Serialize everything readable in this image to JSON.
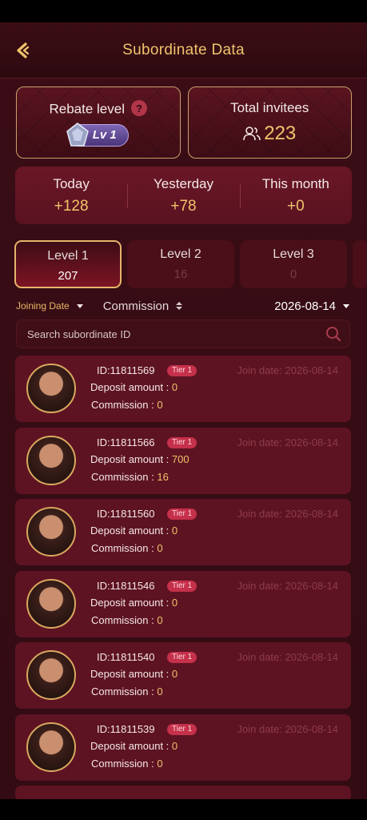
{
  "header": {
    "title": "Subordinate Data",
    "back_icon": "chevron-left-icon"
  },
  "summary": {
    "rebate_label": "Rebate level",
    "rebate_badge": "Lv 1",
    "invitees_label": "Total invitees",
    "invitees_value": "223"
  },
  "stats": [
    {
      "label": "Today",
      "value": "+128"
    },
    {
      "label": "Yesterday",
      "value": "+78"
    },
    {
      "label": "This month",
      "value": "+0"
    }
  ],
  "levels": [
    {
      "label": "Level 1",
      "value": "207"
    },
    {
      "label": "Level 2",
      "value": "16"
    },
    {
      "label": "Level 3",
      "value": "0"
    }
  ],
  "filters": {
    "joining_date": "Joining Date",
    "commission": "Commission",
    "date": "2026-08-14"
  },
  "search": {
    "placeholder": "Search subordinate ID"
  },
  "colors": {
    "accent_gold": "#f0c36b",
    "tier_badge": "#c5304a",
    "card_bg": "#5e1322"
  },
  "list": [
    {
      "id": "ID:11811569",
      "tier": "Tier 1",
      "join": "Join date: 2026-08-14",
      "deposit_label": "Deposit amount : ",
      "deposit": "0",
      "commission_label": "Commission : ",
      "commission": "0"
    },
    {
      "id": "ID:11811566",
      "tier": "Tier 1",
      "join": "Join date: 2026-08-14",
      "deposit_label": "Deposit amount : ",
      "deposit": "700",
      "commission_label": "Commission : ",
      "commission": "16"
    },
    {
      "id": "ID:11811560",
      "tier": "Tier 1",
      "join": "Join date: 2026-08-14",
      "deposit_label": "Deposit amount : ",
      "deposit": "0",
      "commission_label": "Commission : ",
      "commission": "0"
    },
    {
      "id": "ID:11811546",
      "tier": "Tier 1",
      "join": "Join date: 2026-08-14",
      "deposit_label": "Deposit amount : ",
      "deposit": "0",
      "commission_label": "Commission : ",
      "commission": "0"
    },
    {
      "id": "ID:11811540",
      "tier": "Tier 1",
      "join": "Join date: 2026-08-14",
      "deposit_label": "Deposit amount : ",
      "deposit": "0",
      "commission_label": "Commission : ",
      "commission": "0"
    },
    {
      "id": "ID:11811539",
      "tier": "Tier 1",
      "join": "Join date: 2026-08-14",
      "deposit_label": "Deposit amount : ",
      "deposit": "0",
      "commission_label": "Commission : ",
      "commission": "0"
    }
  ]
}
